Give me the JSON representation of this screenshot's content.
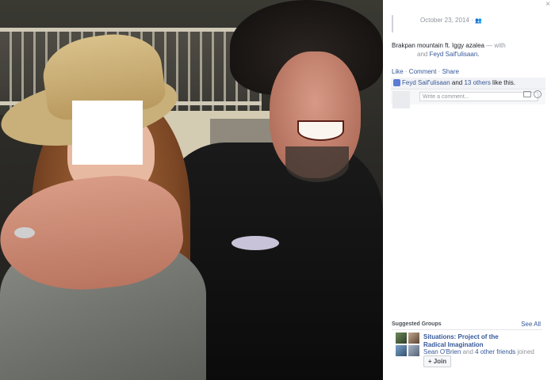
{
  "panel": {
    "close_label": "×",
    "timestamp": "October 23, 2014 · ",
    "audience_icon": "friends-icon",
    "caption_text": "Brakpan mountain ft. Iggy azalea",
    "caption_with": " — with",
    "caption_and": "and",
    "tagged_name": "Feyd Saif'ulisaan",
    "caption_end": ".",
    "actions": {
      "like": "Like",
      "comment": "Comment",
      "share": "Share",
      "sep": " · "
    },
    "likes": {
      "name": "Feyd Saif'ulisaan",
      "and": " and ",
      "others": "13 others",
      "suffix": " like this."
    },
    "comment_placeholder": "Write a comment..."
  },
  "suggested": {
    "title": "Suggested Groups",
    "see_all": "See All",
    "group_name": "Situations: Project of the Radical Imagination",
    "member_name": "Sean O'Brien",
    "members_and": " and ",
    "members_count": "4 other friends",
    "members_suffix": " joined",
    "join_label": "+ Join"
  }
}
